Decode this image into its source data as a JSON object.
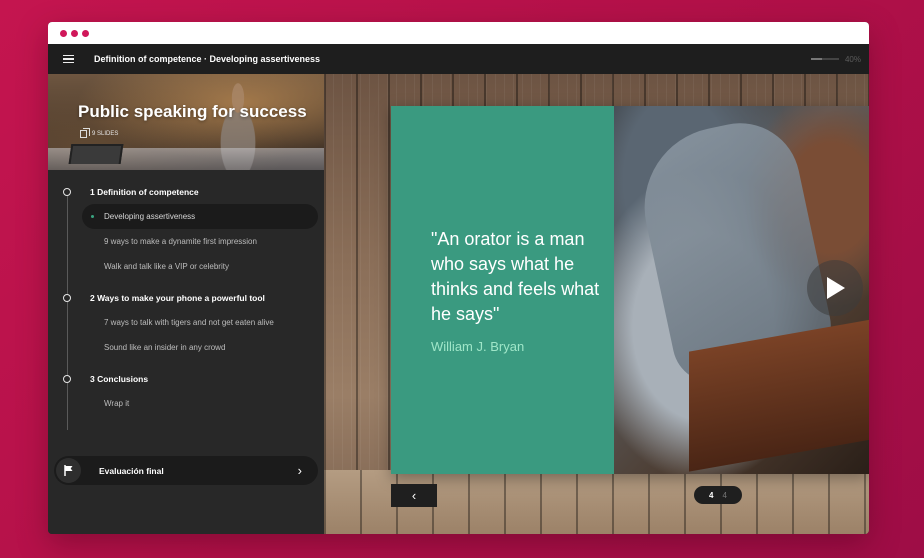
{
  "window": {
    "chrome_dots": 3
  },
  "topbar": {
    "breadcrumb": "Definition of competence · Developing assertiveness",
    "progress_percent": 40,
    "progress_label": "40%"
  },
  "sidebar": {
    "course_title": "Public speaking for success",
    "slides_count_label": "9 SLIDES",
    "sections": [
      {
        "label": "1  Definition of competence",
        "items": [
          {
            "label": "Developing assertiveness",
            "active": true
          },
          {
            "label": "9 ways to make a dynamite first impression"
          },
          {
            "label": "Walk and talk like a VIP or celebrity"
          }
        ]
      },
      {
        "label": "2  Ways to make your phone a powerful tool",
        "items": [
          {
            "label": "7 ways to talk with tigers and not get eaten alive"
          },
          {
            "label": "Sound like an insider in any crowd"
          }
        ]
      },
      {
        "label": "3  Conclusions",
        "items": [
          {
            "label": "Wrap it"
          }
        ]
      }
    ],
    "final_evaluation_label": "Evaluación final"
  },
  "slide": {
    "quote": "\"An orator is a man who says what he thinks and feels what he says\"",
    "author": "William J. Bryan",
    "panel_color": "#3a9a80",
    "author_color": "#9fe6c8"
  },
  "pager": {
    "current": "4",
    "total": "4"
  },
  "colors": {
    "background": "#b81250",
    "accent_dot": "#d0175a",
    "active_bullet": "#3aa581"
  }
}
